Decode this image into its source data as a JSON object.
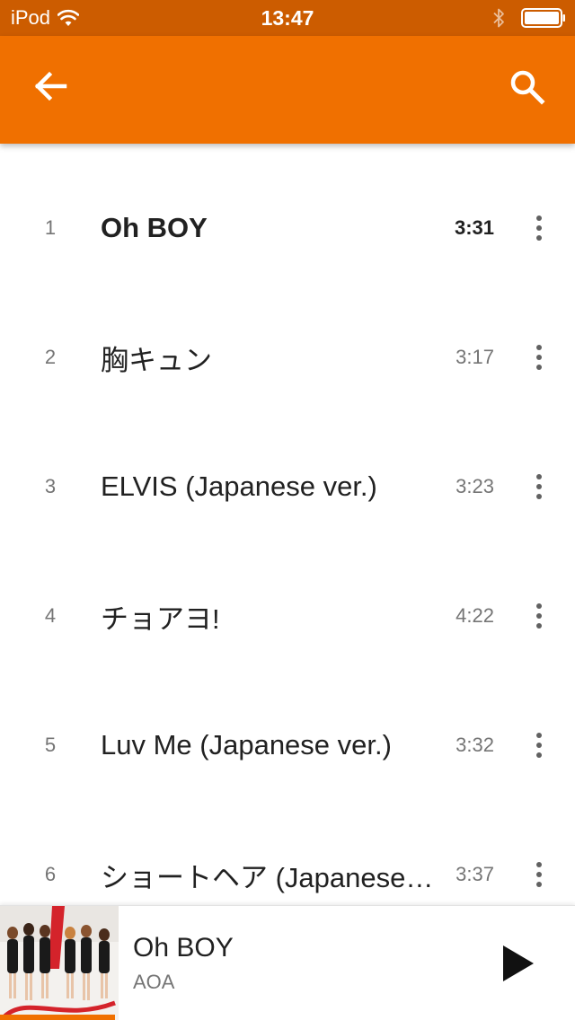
{
  "status_bar": {
    "carrier": "iPod",
    "time": "13:47",
    "icons": [
      "wifi-icon",
      "bluetooth-icon",
      "battery-icon"
    ]
  },
  "app_bar": {
    "color": "#f07000",
    "icons": [
      "back-arrow-icon",
      "search-icon"
    ]
  },
  "tracks": [
    {
      "number": "1",
      "title": "Oh BOY",
      "duration": "3:31",
      "playing": true
    },
    {
      "number": "2",
      "title": "胸キュン",
      "duration": "3:17",
      "playing": false
    },
    {
      "number": "3",
      "title": "ELVIS (Japanese ver.)",
      "duration": "3:23",
      "playing": false
    },
    {
      "number": "4",
      "title": "チョアヨ!",
      "duration": "4:22",
      "playing": false
    },
    {
      "number": "5",
      "title": "Luv Me (Japanese ver.)",
      "duration": "3:32",
      "playing": false
    },
    {
      "number": "6",
      "title": "ショートヘア (Japanese ver.)",
      "duration": "3:37",
      "playing": false
    }
  ],
  "now_playing": {
    "title": "Oh BOY",
    "artist": "AOA",
    "progress": 0.2,
    "icons": [
      "album-art",
      "play-icon"
    ]
  }
}
